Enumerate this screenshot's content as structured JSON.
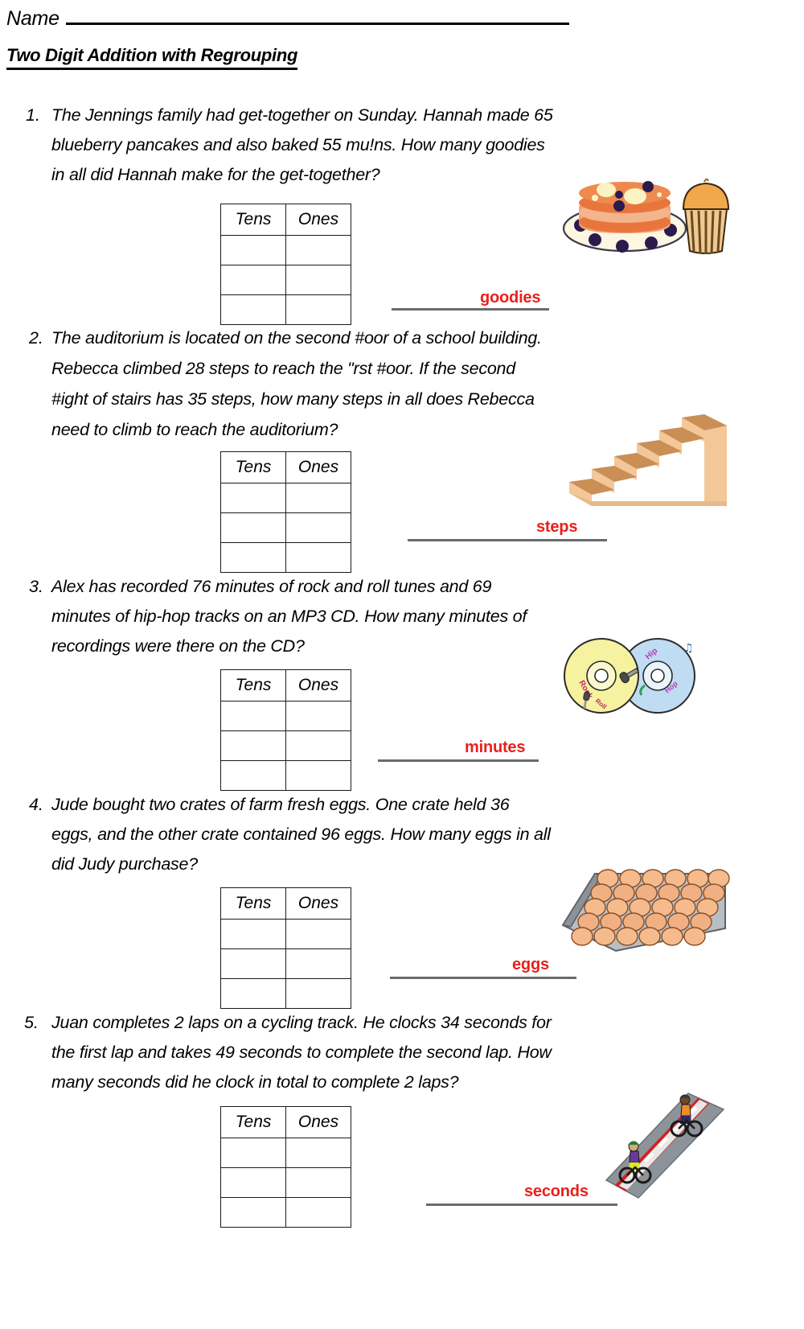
{
  "header": {
    "name_label": "Name",
    "title": "Two Digit Addition with Regrouping"
  },
  "table_headers": {
    "tens": "Tens",
    "ones": "Ones"
  },
  "colors": {
    "unit_red": "#e8211c",
    "rule_grey": "#6b6b6b",
    "table_border": "#1a1a1a",
    "pancake_orange": "#e8763c",
    "blueberry": "#2b1a4d",
    "plate_cream": "#fdf6e0",
    "muffin_top": "#f0a84a",
    "muffin_wrap": "#6b4a22",
    "stairs_light": "#f4c799",
    "stairs_dark": "#c98f55",
    "cd_yellow": "#f7f2a0",
    "cd_blue": "#bfdcf2",
    "egg_peach": "#f5bb8d",
    "tray_grey": "#9aa0a6",
    "track_grey": "#8d9499",
    "track_red": "#d32020"
  },
  "problems": [
    {
      "number": "1.",
      "lines": [
        "The Jennings family had get-together on Sunday. Hannah made 65",
        "blueberry pancakes and also baked 55 mu!ns. How many goodies",
        "in all did Hannah make for the get-together?"
      ],
      "unit": "goodies",
      "art": "pancakes-muffin-clipart"
    },
    {
      "number": "2.",
      "lines": [
        "The auditorium is located on the second #oor of a school building.",
        "Rebecca climbed 28 steps to reach the \"rst #oor. If the second",
        "#ight of stairs has 35 steps, how many steps in all does Rebecca",
        "need to climb to reach the auditorium?"
      ],
      "unit": "steps",
      "art": "stairs-clipart"
    },
    {
      "number": "3.",
      "lines": [
        "Alex has recorded 76 minutes of rock and roll tunes and 69",
        "minutes of hip-hop tracks on an MP3 CD. How many minutes of",
        "recordings were there on the CD?"
      ],
      "unit": "minutes",
      "art": "cds-clipart"
    },
    {
      "number": "4.",
      "lines": [
        "Jude bought two crates of farm fresh eggs. One crate held 36",
        "eggs, and the other crate contained 96 eggs. How many eggs in all",
        "did Judy purchase?"
      ],
      "unit": "eggs",
      "art": "egg-tray-clipart"
    },
    {
      "number": "5.",
      "lines": [
        "Juan completes 2 laps on a cycling track. He clocks 34 seconds for",
        "the first lap and takes 49 seconds to complete the second lap. How",
        "many seconds did he clock in total to complete 2 laps?"
      ],
      "unit": "seconds",
      "art": "cyclists-track-clipart"
    }
  ]
}
